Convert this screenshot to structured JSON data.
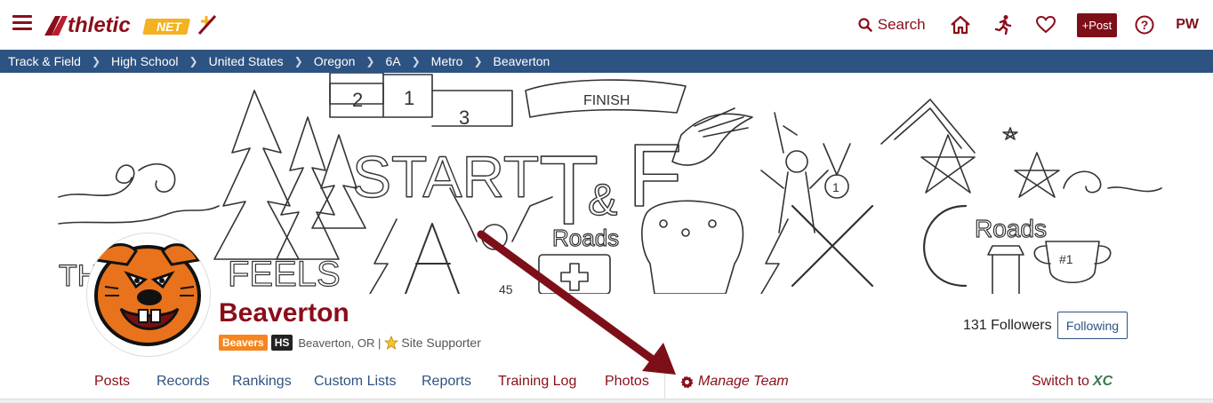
{
  "header": {
    "logo_text": "AthleticNET",
    "search_label": "Search",
    "post_label": "+Post",
    "user_initials": "PW"
  },
  "breadcrumb": [
    "Track & Field",
    "High School",
    "United States",
    "Oregon",
    "6A",
    "Metro",
    "Beaverton"
  ],
  "banner": {
    "podium": [
      "2",
      "1",
      "3"
    ],
    "words": [
      "START",
      "T&F",
      "FINISH",
      "XC",
      "FEELS",
      "Roads",
      "Roads",
      "#1"
    ]
  },
  "team": {
    "name": "Beaverton",
    "mascot_tag": "Beavers",
    "level_tag": "HS",
    "location": "Beaverton, OR |",
    "supporter": "Site Supporter",
    "followers": "131 Followers",
    "follow_button": "Following"
  },
  "tabs": {
    "posts": "Posts",
    "records": "Records",
    "rankings": "Rankings",
    "custom_lists": "Custom Lists",
    "reports": "Reports",
    "training_log": "Training Log",
    "photos": "Photos",
    "manage_team": "Manage Team",
    "switch_to": "Switch to",
    "switch_sport": "XC"
  },
  "colors": {
    "brand_red": "#8b0d1a",
    "nav_blue": "#2d5382",
    "beavers_orange": "#f5861f",
    "xc_green": "#3a7a4a"
  }
}
